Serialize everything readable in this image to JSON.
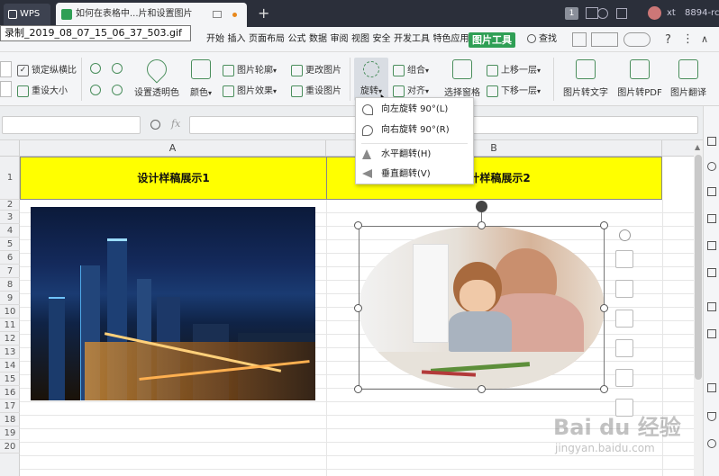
{
  "titlebar": {
    "app_label": "WPS",
    "doc_tab": "如何在表格中...片和设置图片",
    "new_tab": "+",
    "badge": "1",
    "user": "xt",
    "right_text": "8894-rc"
  },
  "tooltip": "录制_2019_08_07_15_06_37_503.gif",
  "menu": {
    "items": [
      "开始",
      "插入",
      "页面布局",
      "公式",
      "数据",
      "审阅",
      "视图",
      "安全",
      "开发工具",
      "特色应用"
    ],
    "active": "图片工具",
    "search": "查找"
  },
  "ribbon": {
    "lock_ratio": "锁定纵横比",
    "reset_size": "重设大小",
    "set_transparent": "设置透明色",
    "color": "颜色",
    "outline": "图片轮廓",
    "effect": "图片效果",
    "change_pic": "更改图片",
    "reset_pic": "重设图片",
    "rotate": "旋转",
    "group": "组合",
    "align": "对齐",
    "select_pane": "选择窗格",
    "bring_forward": "上移一层",
    "send_backward": "下移一层",
    "to_text": "图片转文字",
    "to_pdf": "图片转PDF",
    "translate": "图片翻译"
  },
  "formula": {
    "fx": "fx"
  },
  "columns": [
    "A",
    "B"
  ],
  "rows": [
    "1",
    "2",
    "3",
    "4",
    "5",
    "6",
    "7",
    "8",
    "9",
    "10",
    "11",
    "12",
    "13",
    "14",
    "15",
    "16",
    "17",
    "18",
    "19",
    "20"
  ],
  "cells": {
    "a1": "设计样稿展示1",
    "b1": "设计样稿展示2"
  },
  "dropdown": {
    "items": [
      "向左旋转 90°(L)",
      "向右旋转 90°(R)",
      "水平翻转(H)",
      "垂直翻转(V)"
    ]
  },
  "watermark": {
    "brand": "Bai du 经验",
    "url": "jingyan.baidu.com"
  },
  "colors": {
    "accent": "#2f9f55",
    "header_fill": "#ffff00",
    "titlebar": "#2b2f3a"
  }
}
